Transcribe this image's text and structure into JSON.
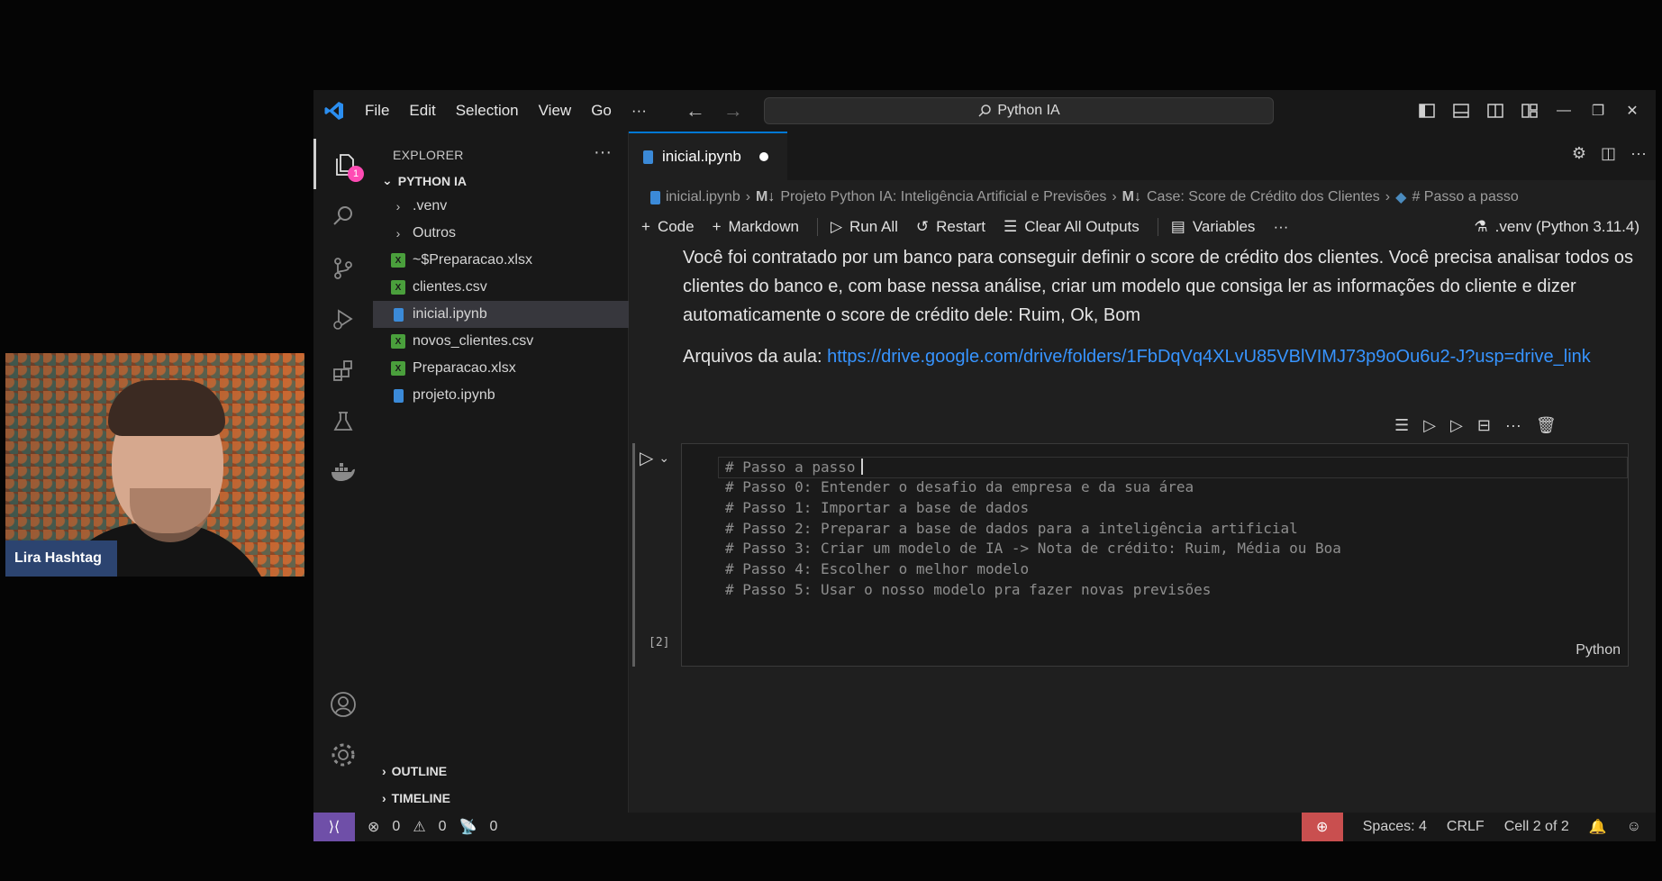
{
  "webcam": {
    "name": "Lira Hashtag"
  },
  "titlebar": {
    "menu": [
      "File",
      "Edit",
      "Selection",
      "View",
      "Go"
    ],
    "more": "···",
    "search": "Python IA"
  },
  "activity": {
    "explorer_badge": "1"
  },
  "explorer": {
    "header": "EXPLORER",
    "more": "···",
    "root": "PYTHON IA",
    "items": [
      {
        "label": ".venv",
        "kind": "folder"
      },
      {
        "label": "Outros",
        "kind": "folder"
      },
      {
        "label": "~$Preparacao.xlsx",
        "kind": "xlsx"
      },
      {
        "label": "clientes.csv",
        "kind": "csv"
      },
      {
        "label": "inicial.ipynb",
        "kind": "notebook"
      },
      {
        "label": "novos_clientes.csv",
        "kind": "csv"
      },
      {
        "label": "Preparacao.xlsx",
        "kind": "xlsx"
      },
      {
        "label": "projeto.ipynb",
        "kind": "notebook"
      }
    ],
    "outline": "OUTLINE",
    "timeline": "TIMELINE"
  },
  "tab": {
    "label": "inicial.ipynb"
  },
  "breadcrumb": {
    "file": "inicial.ipynb",
    "md_marker": "M↓",
    "part1": "Projeto Python IA: Inteligência Artificial e Previsões",
    "part2": "Case: Score de Crédito dos Clientes",
    "part3": "# Passo a passo"
  },
  "toolbar": {
    "code": "Code",
    "markdown": "Markdown",
    "run_all": "Run All",
    "restart": "Restart",
    "clear": "Clear All Outputs",
    "variables": "Variables",
    "more": "···",
    "kernel": ".venv (Python 3.11.4)"
  },
  "markdown": {
    "para1": "Você foi contratado por um banco para conseguir definir o score de crédito dos clientes. Você precisa analisar todos os clientes do banco e, com base nessa análise, criar um modelo que consiga ler as informações do cliente e dizer automaticamente o score de crédito dele: Ruim, Ok, Bom",
    "files_label": "Arquivos da aula: ",
    "files_link": "https://drive.google.com/drive/folders/1FbDqVq4XLvU85VBlVIMJ73p9oOu6u2-J?usp=drive_link"
  },
  "code_cell": {
    "lines": [
      "# Passo a passo",
      "# Passo 0: Entender o desafio da empresa e da sua área",
      "# Passo 1: Importar a base de dados",
      "# Passo 2: Preparar a base de dados para a inteligência artificial",
      "# Passo 3: Criar um modelo de IA -> Nota de crédito: Ruim, Média ou Boa",
      "# Passo 4: Escolher o melhor modelo",
      "# Passo 5: Usar o nosso modelo pra fazer novas previsões"
    ],
    "exec_count": "[2]",
    "language": "Python"
  },
  "status": {
    "errors": "0",
    "warnings": "0",
    "ports": "0",
    "spaces": "Spaces: 4",
    "eol": "CRLF",
    "cell": "Cell 2 of 2"
  }
}
